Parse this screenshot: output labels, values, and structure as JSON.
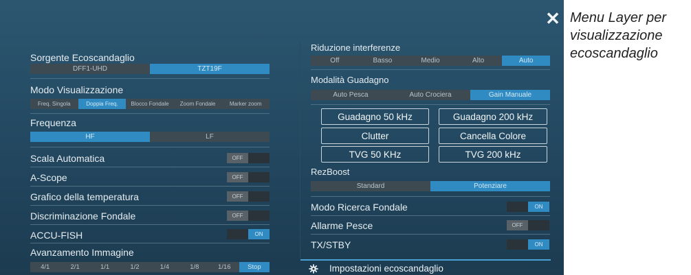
{
  "caption": "Menu Layer per visualizzazione ecoscandaglio",
  "left": {
    "sorgente": {
      "label": "Sorgente Ecoscandaglio",
      "options": [
        "DFF1-UHD",
        "TZT19F"
      ],
      "selected": 1
    },
    "modo": {
      "label": "Modo Visualizzazione",
      "options": [
        "Freq. Singola",
        "Doppia Freq.",
        "Blocco Fondale",
        "Zoom Fondale",
        "Marker zoom"
      ],
      "selected": 1
    },
    "frequenza": {
      "label": "Frequenza",
      "options": [
        "HF",
        "LF"
      ],
      "selected": 0
    },
    "scala": {
      "label": "Scala Automatica",
      "state": "OFF"
    },
    "ascope": {
      "label": "A-Scope",
      "state": "OFF"
    },
    "grafico": {
      "label": "Grafico della temperatura",
      "state": "OFF"
    },
    "discriminazione": {
      "label": "Discriminazione Fondale",
      "state": "OFF"
    },
    "accufish": {
      "label": "ACCU-FISH",
      "state": "ON"
    },
    "avanzamento": {
      "label": "Avanzamento Immagine",
      "options": [
        "4/1",
        "2/1",
        "1/1",
        "1/2",
        "1/4",
        "1/8",
        "1/16",
        "Stop"
      ],
      "selected": 7
    }
  },
  "right": {
    "riduzione": {
      "label": "Riduzione interferenze",
      "options": [
        "Off",
        "Basso",
        "Medio",
        "Alto",
        "Auto"
      ],
      "selected": 4
    },
    "guadagno": {
      "label": "Modalità Guadagno",
      "options": [
        "Auto Pesca",
        "Auto Crociera",
        "Gain Manuale"
      ],
      "selected": 2
    },
    "buttons": [
      "Guadagno 50 kHz",
      "Guadagno 200 kHz",
      "Clutter",
      "Cancella Colore",
      "TVG 50 KHz",
      "TVG 200 kHz"
    ],
    "rezboost": {
      "label": "RezBoost",
      "options": [
        "Standard",
        "Potenziare"
      ],
      "selected": 1
    },
    "ricerca": {
      "label": "Modo Ricerca Fondale",
      "state": "ON"
    },
    "allarme": {
      "label": "Allarme Pesce",
      "state": "OFF"
    },
    "txstby": {
      "label": "TX/STBY",
      "state": "ON"
    },
    "settings": "Impostazioni ecoscandaglio"
  },
  "colors": {
    "accent": "#2f8bc2",
    "panel_top": "#2c5670",
    "panel_bottom": "#1c3b50"
  },
  "icons": {
    "close": "close-icon",
    "settings": "gear-icon"
  }
}
